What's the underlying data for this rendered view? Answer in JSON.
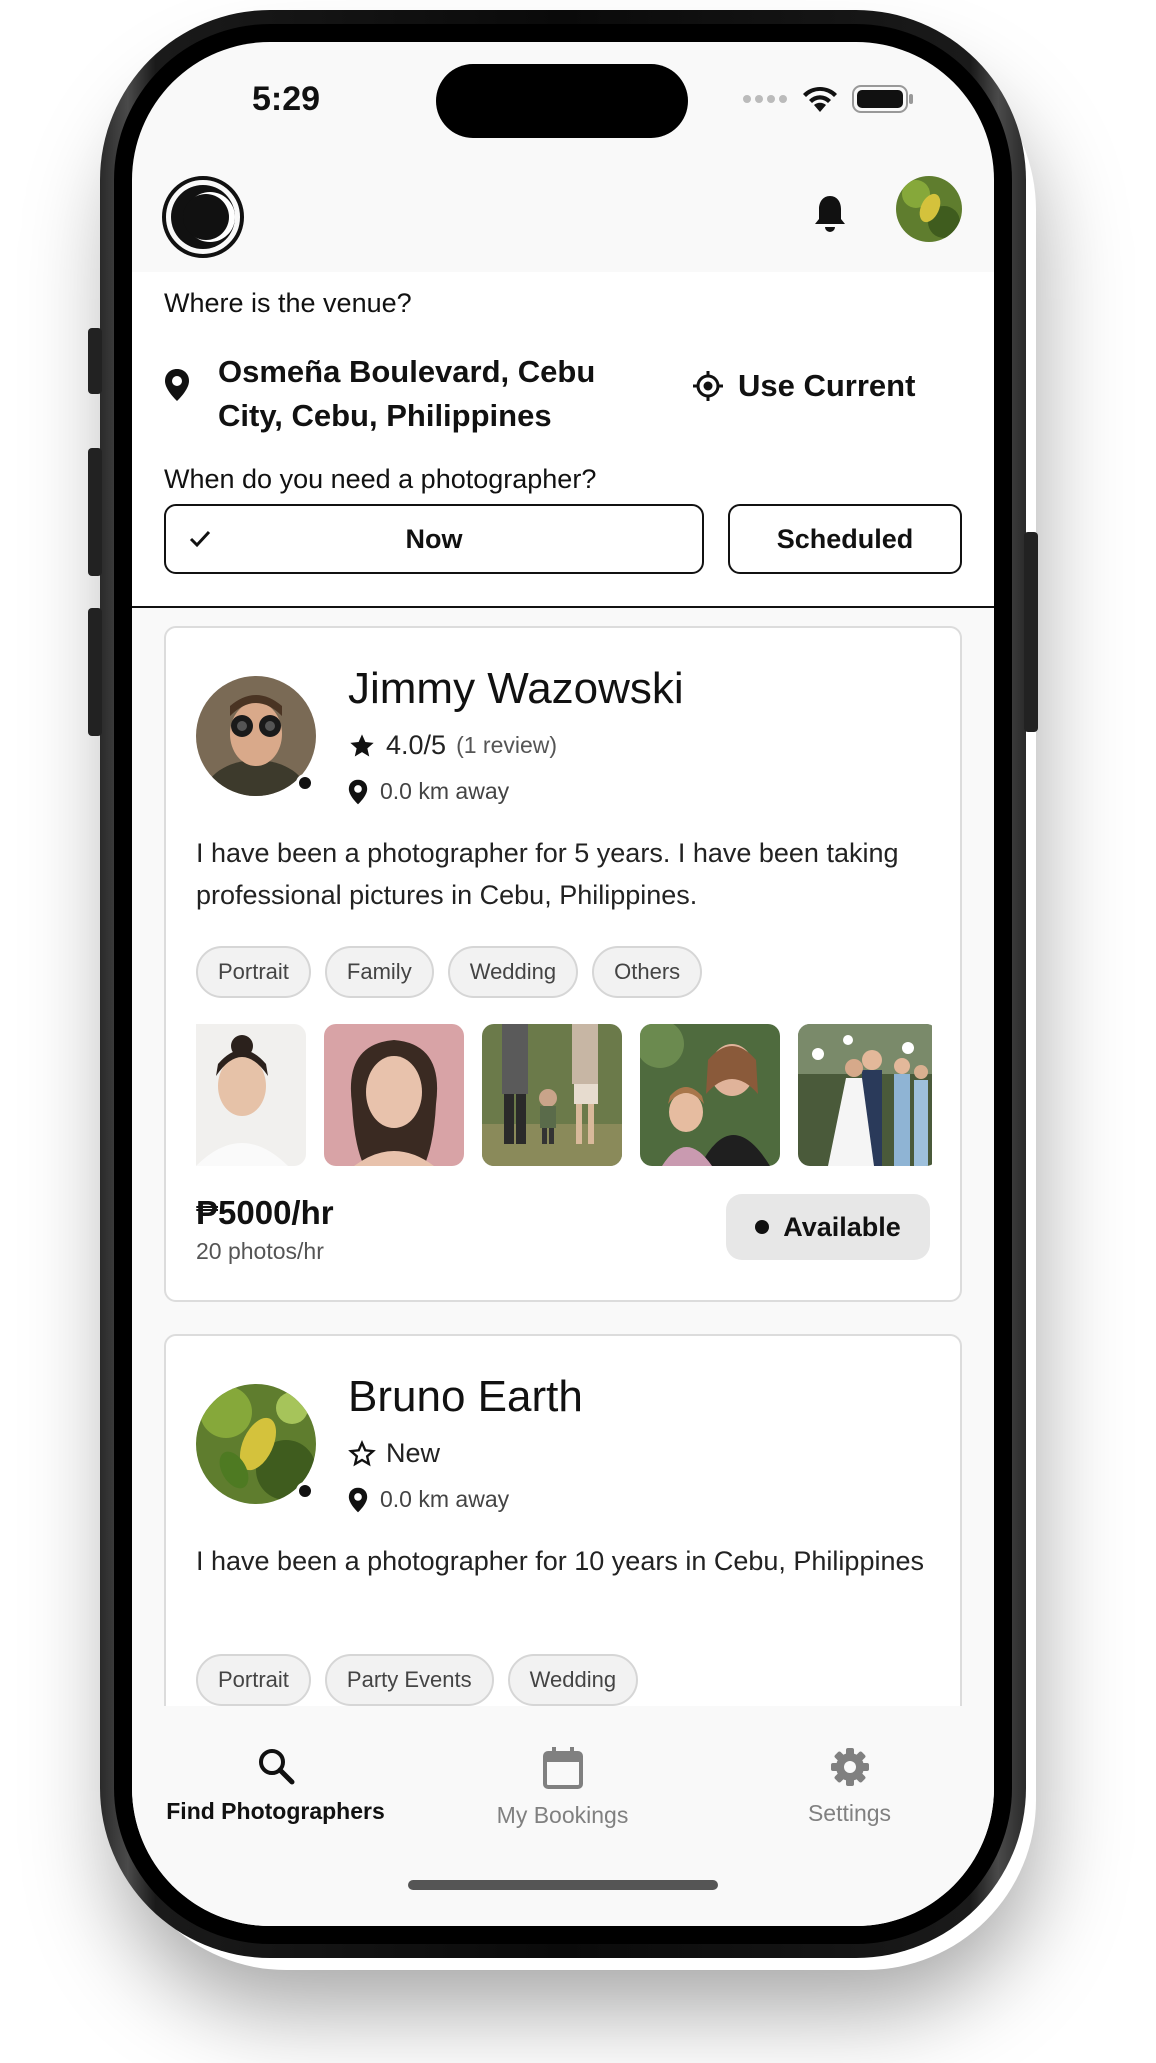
{
  "status_bar": {
    "time": "5:29"
  },
  "header": {
    "logo": "camera-aperture-logo",
    "notification_icon": "bell-icon",
    "avatar": "user-avatar-leaf"
  },
  "venue": {
    "question": "Where is the venue?",
    "address": "Osmeña Boulevard, Cebu City, Cebu, Philippines",
    "use_current_label": "Use Current"
  },
  "timing": {
    "question": "When do you need a photographer?",
    "options": [
      "Now",
      "Scheduled"
    ],
    "selected": "Now"
  },
  "photographers": [
    {
      "name": "Jimmy Wazowski",
      "rating": "4.0/5",
      "reviews": "(1 review)",
      "distance": "0.0 km away",
      "bio": "I have been a photographer for 5 years. I have been taking professional pictures in Cebu, Philippines.",
      "tags": [
        "Portrait",
        "Family",
        "Wedding",
        "Others"
      ],
      "price": "₱5000/hr",
      "photos_per_hour": "20 photos/hr",
      "status": "Available"
    },
    {
      "name": "Bruno Earth",
      "rating": "New",
      "distance": "0.0 km away",
      "bio": "I have been a photographer for 10 years in Cebu, Philippines",
      "tags": [
        "Portrait",
        "Party Events",
        "Wedding"
      ]
    }
  ],
  "bottom_nav": [
    {
      "label": "Find Photographers",
      "icon": "search-icon",
      "active": true
    },
    {
      "label": "My Bookings",
      "icon": "calendar-icon",
      "active": false
    },
    {
      "label": "Settings",
      "icon": "gear-icon",
      "active": false
    }
  ]
}
